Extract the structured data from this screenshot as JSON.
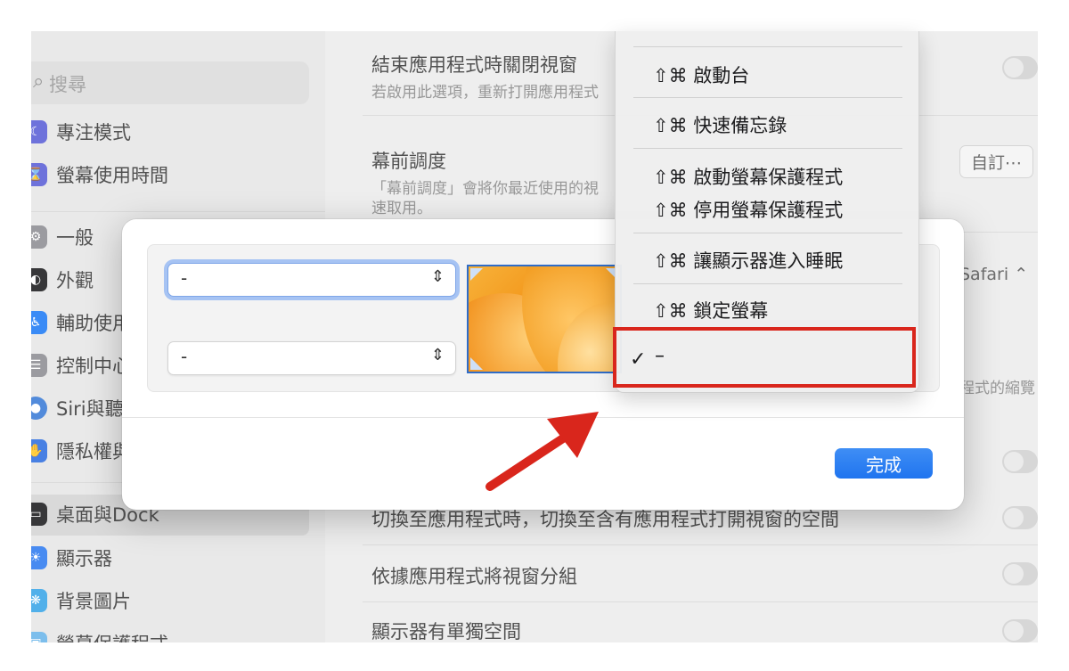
{
  "search": {
    "placeholder": "搜尋"
  },
  "sidebar": {
    "items": [
      {
        "label": "專注模式",
        "icon": "moon-icon",
        "color": "#5b5fd6"
      },
      {
        "label": "螢幕使用時間",
        "icon": "hourglass-icon",
        "color": "#5b5fd6"
      },
      {
        "label": "一般",
        "icon": "gear-icon",
        "color": "#8e8e93"
      },
      {
        "label": "外觀",
        "icon": "appearance-icon",
        "color": "#1c1c1e"
      },
      {
        "label": "輔助使用",
        "icon": "accessibility-icon",
        "color": "#1f7cf5"
      },
      {
        "label": "控制中心",
        "icon": "control-center-icon",
        "color": "#8e8e93"
      },
      {
        "label": "Siri與聽寫",
        "icon": "siri-icon",
        "color": "#3b7bd6"
      },
      {
        "label": "隱私權與安全性",
        "icon": "hand-icon",
        "color": "#2f6fe0"
      },
      {
        "label": "桌面與Dock",
        "icon": "dock-icon",
        "color": "#1c1c1e"
      },
      {
        "label": "顯示器",
        "icon": "display-icon",
        "color": "#2f7cf0"
      },
      {
        "label": "背景圖片",
        "icon": "wallpaper-icon",
        "color": "#3aa6e8"
      },
      {
        "label": "螢幕保護程式",
        "icon": "screensaver-icon",
        "color": "#6ab6ea"
      }
    ]
  },
  "content": {
    "close_windows_title": "結束應用程式時關閉視窗",
    "close_windows_sub": "若啟用此選項，重新打開應用程式",
    "stage_manager_title": "幕前調度",
    "stage_manager_sub": "「幕前調度」會將你最近使用的視",
    "stage_manager_sub2": "速取用。",
    "customize_label": "自訂⋯",
    "browser_label": "Safari",
    "thumbs_sub": "程式的縮覽",
    "switch_space_title": "切換至應用程式時，切換至含有應用程式打開視窗的空間",
    "group_windows_title": "依據應用程式將視窗分組",
    "separate_spaces_title": "顯示器有單獨空間"
  },
  "sheet": {
    "popup_top_value": "-",
    "popup_bottom_value": "-",
    "done_label": "完成"
  },
  "menu": {
    "items": [
      "⇧⌘ 啟動台",
      "⇧⌘ 快速備忘錄",
      "⇧⌘ 啟動螢幕保護程式",
      "⇧⌘ 停用螢幕保護程式",
      "⇧⌘ 讓顯示器進入睡眠",
      "⇧⌘ 鎖定螢幕"
    ],
    "selected_check": "✓",
    "selected_value": "–"
  },
  "annotation": {
    "highlight_color": "#d9261c"
  }
}
